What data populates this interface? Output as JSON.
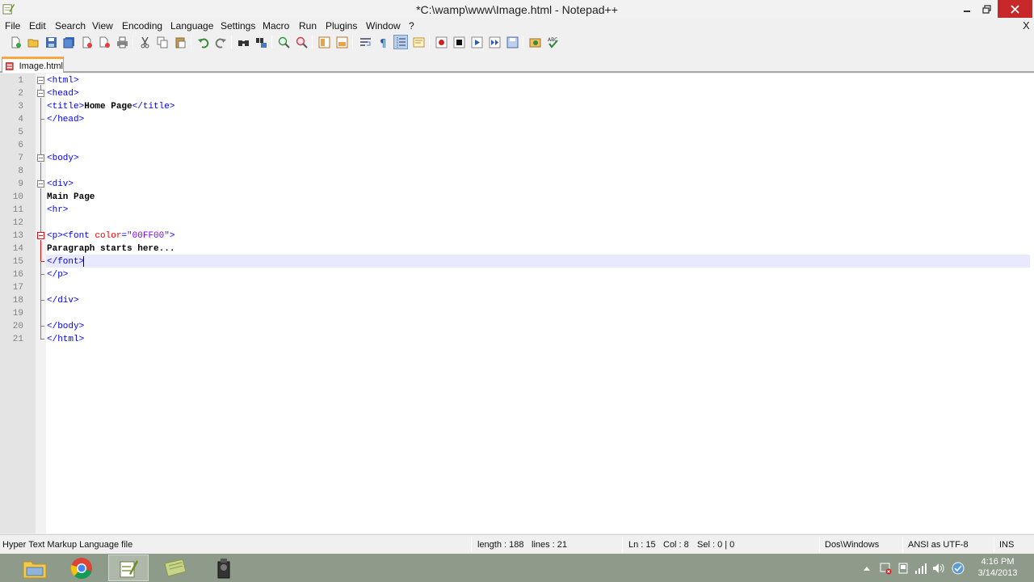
{
  "window": {
    "title": "*C:\\wamp\\www\\Image.html - Notepad++",
    "minimize_icon": "minimize-icon",
    "restore_icon": "restore-icon",
    "close_icon": "close-icon"
  },
  "menu": {
    "items": [
      "File",
      "Edit",
      "Search",
      "View",
      "Encoding",
      "Language",
      "Settings",
      "Macro",
      "Run",
      "Plugins",
      "Window",
      "?"
    ],
    "close_label": "X"
  },
  "toolbar": {
    "icons": [
      "new-file-icon",
      "open-file-icon",
      "save-icon",
      "save-all-icon",
      "close-icon",
      "close-all-icon",
      "print-icon",
      "cut-icon",
      "copy-icon",
      "paste-icon",
      "undo-icon",
      "redo-icon",
      "find-icon",
      "replace-icon",
      "zoom-in-icon",
      "zoom-out-icon",
      "sync-vertical-icon",
      "sync-horizontal-icon",
      "word-wrap-icon",
      "show-all-chars-icon",
      "indent-guide-icon",
      "doc-map-icon",
      "record-macro-icon",
      "stop-macro-icon",
      "play-macro-icon",
      "run-macro-multiple-icon",
      "save-macro-icon",
      "launch-browser-icon",
      "spell-check-icon"
    ]
  },
  "tabs": [
    {
      "label": "Image.html",
      "icon": "unsaved-file-icon",
      "active": true
    }
  ],
  "editor": {
    "current_line": 15,
    "lines": [
      {
        "n": "1",
        "tokens": [
          [
            "tag",
            "<html>"
          ]
        ]
      },
      {
        "n": "2",
        "tokens": [
          [
            "tag",
            "<head>"
          ]
        ]
      },
      {
        "n": "3",
        "tokens": [
          [
            "tag",
            "<title>"
          ],
          [
            "txt",
            "Home Page"
          ],
          [
            "tag",
            "</title>"
          ]
        ]
      },
      {
        "n": "4",
        "tokens": [
          [
            "tag",
            "</head>"
          ]
        ]
      },
      {
        "n": "5",
        "tokens": []
      },
      {
        "n": "6",
        "tokens": []
      },
      {
        "n": "7",
        "tokens": [
          [
            "tag",
            "<body>"
          ]
        ]
      },
      {
        "n": "8",
        "tokens": []
      },
      {
        "n": "9",
        "tokens": [
          [
            "tag",
            "<div>"
          ]
        ]
      },
      {
        "n": "10",
        "tokens": [
          [
            "txt",
            "Main Page"
          ]
        ]
      },
      {
        "n": "11",
        "tokens": [
          [
            "tag",
            "<hr>"
          ]
        ]
      },
      {
        "n": "12",
        "tokens": []
      },
      {
        "n": "13",
        "tokens": [
          [
            "tag",
            "<p><font "
          ],
          [
            "attr",
            "color"
          ],
          [
            "tag",
            "="
          ],
          [
            "val",
            "\"00FF00\""
          ],
          [
            "tag",
            ">"
          ]
        ]
      },
      {
        "n": "14",
        "tokens": [
          [
            "txt",
            "Paragraph starts here..."
          ]
        ]
      },
      {
        "n": "15",
        "tokens": [
          [
            "tag",
            "</font>"
          ]
        ]
      },
      {
        "n": "16",
        "tokens": [
          [
            "tag",
            "</p>"
          ]
        ]
      },
      {
        "n": "17",
        "tokens": []
      },
      {
        "n": "18",
        "tokens": [
          [
            "tag",
            "</div>"
          ]
        ]
      },
      {
        "n": "19",
        "tokens": []
      },
      {
        "n": "20",
        "tokens": [
          [
            "tag",
            "</body>"
          ]
        ]
      },
      {
        "n": "21",
        "tokens": [
          [
            "tag",
            "</html>"
          ]
        ]
      }
    ]
  },
  "statusbar": {
    "file_type": "Hyper Text Markup Language file",
    "length": "length : 188",
    "lines": "lines : 21",
    "ln": "Ln : 15",
    "col": "Col : 8",
    "sel": "Sel : 0 | 0",
    "eol": "Dos\\Windows",
    "encoding": "ANSI as UTF-8",
    "ins": "INS"
  },
  "taskbar": {
    "apps": [
      "file-explorer-icon",
      "chrome-icon",
      "notepad-plus-plus-icon",
      "notes-app-icon",
      "media-app-icon"
    ],
    "tray_icons": [
      "show-hidden-icons-chevron",
      "action-center-icon",
      "device-icon",
      "network-signal-icon",
      "volume-icon",
      "update-icon"
    ],
    "time": "4:16 PM",
    "date": "3/14/2013"
  }
}
